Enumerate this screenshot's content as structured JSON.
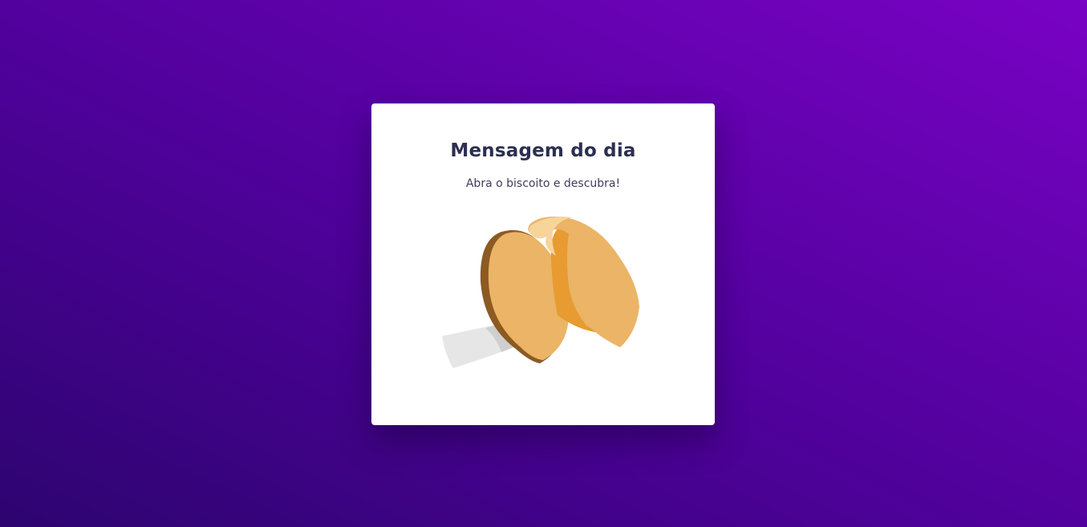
{
  "card": {
    "title": "Mensagem do dia",
    "subtitle": "Abra o biscoito e descubra!"
  },
  "cookie": {
    "icon": "fortune-cookie-icon",
    "colors": {
      "dough": "#EBB466",
      "dough_dark": "#E89B30",
      "edge": "#8C5A22",
      "highlight": "#F7D49A",
      "paper": "#E6E6E6",
      "paper_shadow": "#CFCFCF"
    }
  },
  "colors": {
    "background_start": "#2d0470",
    "background_end": "#7902c4",
    "title": "#2c2f52",
    "text": "#3d3f5c"
  }
}
